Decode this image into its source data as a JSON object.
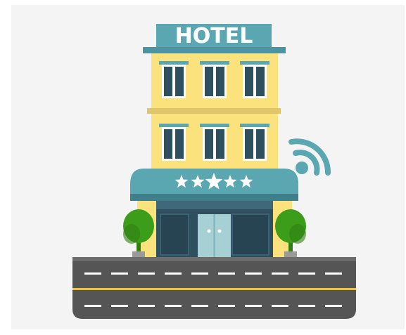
{
  "sign": {
    "text": "HOTEL"
  },
  "rating": {
    "stars": 5
  },
  "icons": {
    "wifi": "wifi-icon",
    "trees": "tree-icon"
  },
  "colors": {
    "background": "#f4f4f4",
    "facade": "#fbe27c",
    "facade_trim": "#e0c56a",
    "sign": "#5aa7b1",
    "sign_roof": "#4c95a0",
    "window_frame": "#ffffff",
    "window_glass": "#2e4f5e",
    "awning": "#5aa7b1",
    "awning_dark": "#3f7f8a",
    "entrance": "#2e4f5e",
    "door": "#a7d0d4",
    "tree": "#3c9d1a",
    "tree_dark": "#2f7f12",
    "road": "#555555",
    "road_edge": "#6c6c6c",
    "lane_marking": "#ffffff",
    "center_line": "#f2c231",
    "wifi": "#5aa7b1"
  }
}
